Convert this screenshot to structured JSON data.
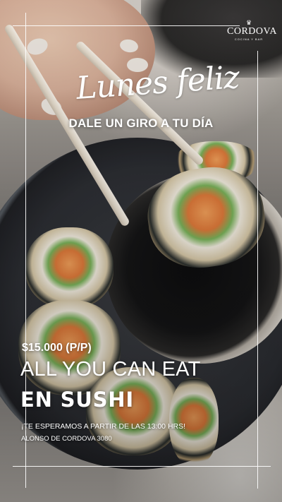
{
  "brand": {
    "name": "CORDOVA",
    "subtitle": "COCINA Y BAR",
    "mark": "♛"
  },
  "headline": {
    "script": "Lunes feliz",
    "tagline": "DALE UN GIRO A TU DÍA"
  },
  "offer": {
    "price": "$15.000 (P/P)",
    "line1": "ALL YOU CAN EAT",
    "line2": "EN SUSHI"
  },
  "info": {
    "invite": "¡TE ESPERAMOS A PARTIR DE LAS 13:00 HRS!",
    "address": "ALONSO DE CORDOVA 3080"
  },
  "colors": {
    "text": "#ffffff",
    "plate": "#2c2e33",
    "soy_bowl": "#e3ded6"
  }
}
